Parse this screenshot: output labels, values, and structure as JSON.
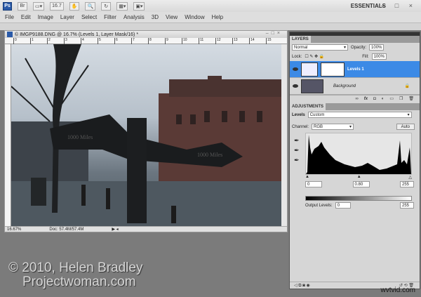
{
  "app": {
    "logo": "Ps",
    "bridge": "Br",
    "zoom": "16.7",
    "workspace": "ESSENTIALS",
    "win_controls": "– □ ×"
  },
  "menu": [
    "File",
    "Edit",
    "Image",
    "Layer",
    "Select",
    "Filter",
    "Analysis",
    "3D",
    "View",
    "Window",
    "Help"
  ],
  "document": {
    "title": "© IMGP9188.DNG @ 16.7% (Levels 1, Layer Mask/16) *",
    "ruler": [
      "0",
      "1",
      "2",
      "3",
      "4",
      "5",
      "6",
      "7",
      "8",
      "9",
      "10",
      "11",
      "12",
      "13",
      "14",
      "15"
    ],
    "zoom": "16.67%",
    "doc_size": "Doc: 57.4M/57.4M",
    "sign_text": "1000 Miles"
  },
  "layers": {
    "tab": "LAYERS",
    "blend": "Normal",
    "opacity_label": "Opacity:",
    "opacity": "100%",
    "lock_label": "Lock:",
    "fill_label": "Fill:",
    "fill": "100%",
    "items": [
      {
        "name": "Levels 1"
      },
      {
        "name": "Background"
      }
    ],
    "footer": "fx"
  },
  "adjustments": {
    "tab": "ADJUSTMENTS",
    "type": "Levels",
    "preset": "Custom",
    "channel_label": "Channel:",
    "channel": "RGB",
    "auto": "Auto",
    "input_black": "0",
    "input_gamma": "0.80",
    "input_white": "255",
    "output_label": "Output Levels:",
    "output_black": "0",
    "output_white": "255"
  },
  "watermark": {
    "line1": "© 2010, Helen Bradley",
    "line2": "Projectwoman.com",
    "corner": "wvtvid.com"
  }
}
